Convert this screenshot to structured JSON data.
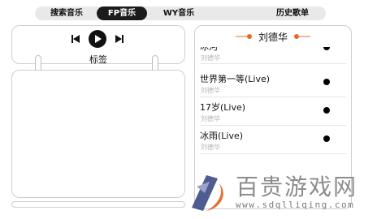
{
  "tabs": [
    {
      "label": "搜索音乐",
      "active": false
    },
    {
      "label": "FP音乐",
      "active": true
    },
    {
      "label": "WY音乐",
      "active": false
    },
    {
      "label": "历史歌单",
      "active": false
    }
  ],
  "player": {
    "tag_label": "标签"
  },
  "playlist": {
    "header": "刘德华",
    "items": [
      {
        "title": "冰河",
        "artist": "刘德华"
      },
      {
        "title": "世界第一等(Live)",
        "artist": "刘德华"
      },
      {
        "title": "17岁(Live)",
        "artist": "刘德华"
      },
      {
        "title": "冰雨(Live)",
        "artist": "刘德华"
      },
      {
        "title": "",
        "artist": ""
      }
    ]
  },
  "watermark": {
    "text": "百贵游戏网",
    "url": "www.sdqlliqing.com"
  },
  "colors": {
    "accent": "#e8682b",
    "tab_active_bg": "#1b1b1b",
    "tabbar_bg": "#e9e9e9",
    "border": "#cfcfcf"
  }
}
